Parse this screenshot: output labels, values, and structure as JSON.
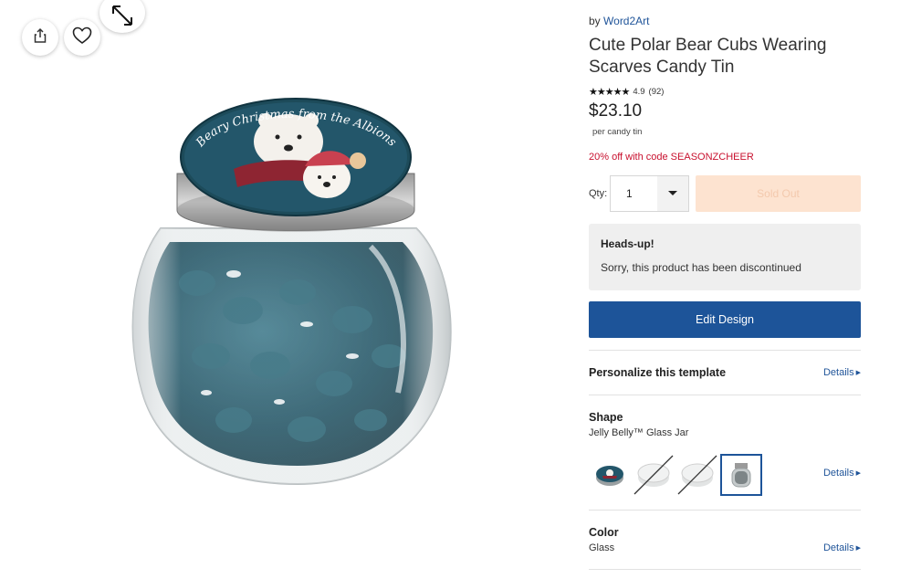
{
  "seller": {
    "prefix": "by",
    "name": "Word2Art"
  },
  "product": {
    "title": "Cute Polar Bear Cubs Wearing Scarves Candy Tin",
    "lid_text": "Beary Christmas from the Albions",
    "rating": {
      "stars": "★★★★★",
      "value": "4.9",
      "count": "(92)"
    },
    "price": "$23.10",
    "price_unit": "per candy tin",
    "promo": "20% off with code SEASONZCHEER"
  },
  "quantity": {
    "label": "Qty:",
    "value": "1"
  },
  "buttons": {
    "sold_out": "Sold Out",
    "edit_design": "Edit Design"
  },
  "alert": {
    "title": "Heads-up!",
    "message": "Sorry, this product has been discontinued"
  },
  "personalize": {
    "title": "Personalize this template",
    "details": "Details"
  },
  "shape": {
    "title": "Shape",
    "value": "Jelly Belly™ Glass Jar",
    "details": "Details",
    "options": [
      "tin",
      "unavailable-1",
      "unavailable-2",
      "glass-jar"
    ],
    "selected_index": 3
  },
  "color": {
    "title": "Color",
    "value": "Glass",
    "details": "Details"
  },
  "icons": {
    "share": "share-icon",
    "heart": "heart-icon",
    "expand": "expand-icon",
    "caret": "caret-down-icon",
    "arrow": "triangle-right-icon"
  },
  "colors": {
    "accent": "#1d5499",
    "link": "#1f5499",
    "promo": "#c8102e",
    "sold_out_bg": "#fde3d0",
    "alert_bg": "#efefef"
  }
}
